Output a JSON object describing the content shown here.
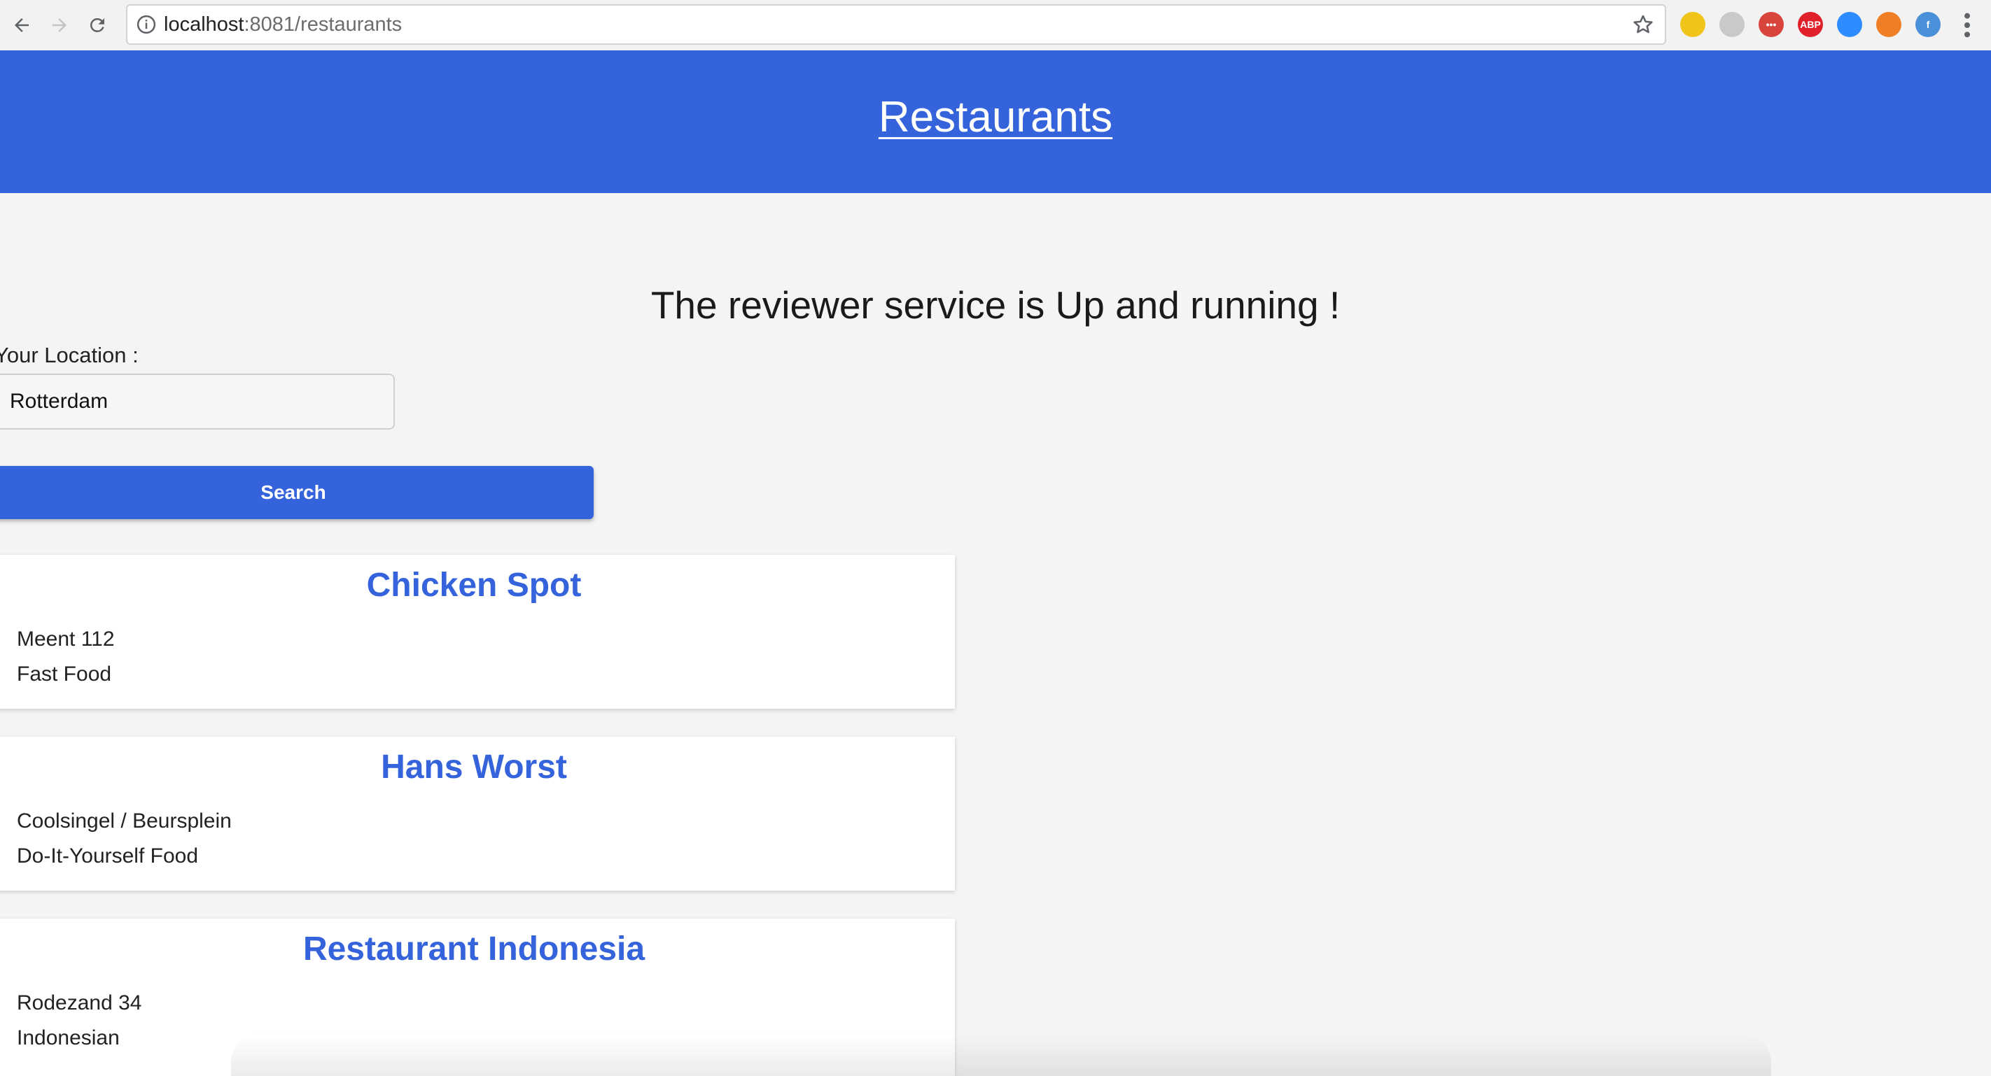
{
  "browser": {
    "url_host": "localhost",
    "url_rest": ":8081/restaurants",
    "extensions": [
      {
        "icon": "cube-extension-icon",
        "color": "#f0c419",
        "label": ""
      },
      {
        "icon": "circle-extension-icon",
        "color": "#c9c9c9",
        "label": ""
      },
      {
        "icon": "dots-extension-icon",
        "color": "#d9453d",
        "label": "•••"
      },
      {
        "icon": "adblock-plus-icon",
        "color": "#e0202a",
        "label": "ABP"
      },
      {
        "icon": "video-extension-icon",
        "color": "#2d8cff",
        "label": ""
      },
      {
        "icon": "orange-extension-icon",
        "color": "#f07e24",
        "label": ""
      },
      {
        "icon": "f-extension-icon",
        "color": "#4a90d9",
        "label": "f"
      }
    ]
  },
  "header": {
    "title": "Restaurants"
  },
  "status": {
    "message": "The reviewer service is Up and running !"
  },
  "search": {
    "label": "Your Location :",
    "value": "Rotterdam",
    "button_label": "Search"
  },
  "restaurants": [
    {
      "name": "Chicken Spot",
      "address": "Meent 112",
      "category": "Fast Food"
    },
    {
      "name": "Hans Worst",
      "address": "Coolsingel / Beursplein",
      "category": "Do-It-Yourself Food"
    },
    {
      "name": "Restaurant Indonesia",
      "address": "Rodezand 34",
      "category": "Indonesian"
    }
  ],
  "colors": {
    "brand_blue": "#3463dc",
    "page_background": "#f4f4f4"
  }
}
